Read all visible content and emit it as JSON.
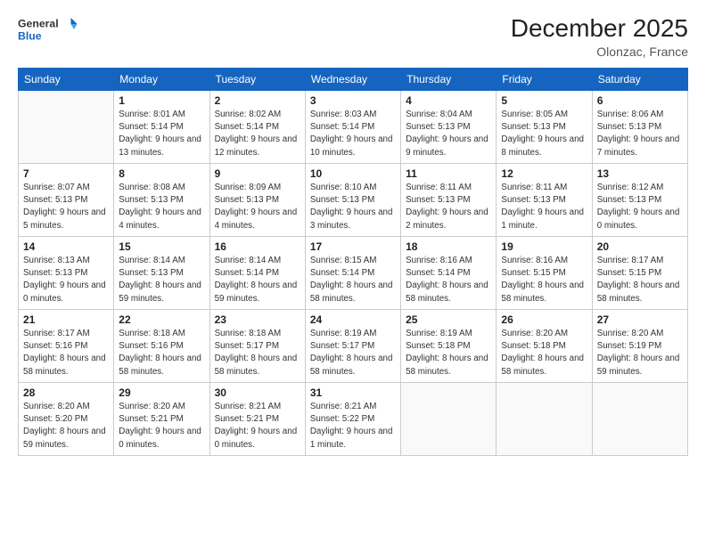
{
  "logo": {
    "line1": "General",
    "line2": "Blue"
  },
  "title": "December 2025",
  "location": "Olonzac, France",
  "days_header": [
    "Sunday",
    "Monday",
    "Tuesday",
    "Wednesday",
    "Thursday",
    "Friday",
    "Saturday"
  ],
  "weeks": [
    [
      {
        "num": "",
        "empty": true
      },
      {
        "num": "1",
        "sunrise": "Sunrise: 8:01 AM",
        "sunset": "Sunset: 5:14 PM",
        "daylight": "Daylight: 9 hours and 13 minutes."
      },
      {
        "num": "2",
        "sunrise": "Sunrise: 8:02 AM",
        "sunset": "Sunset: 5:14 PM",
        "daylight": "Daylight: 9 hours and 12 minutes."
      },
      {
        "num": "3",
        "sunrise": "Sunrise: 8:03 AM",
        "sunset": "Sunset: 5:14 PM",
        "daylight": "Daylight: 9 hours and 10 minutes."
      },
      {
        "num": "4",
        "sunrise": "Sunrise: 8:04 AM",
        "sunset": "Sunset: 5:13 PM",
        "daylight": "Daylight: 9 hours and 9 minutes."
      },
      {
        "num": "5",
        "sunrise": "Sunrise: 8:05 AM",
        "sunset": "Sunset: 5:13 PM",
        "daylight": "Daylight: 9 hours and 8 minutes."
      },
      {
        "num": "6",
        "sunrise": "Sunrise: 8:06 AM",
        "sunset": "Sunset: 5:13 PM",
        "daylight": "Daylight: 9 hours and 7 minutes."
      }
    ],
    [
      {
        "num": "7",
        "sunrise": "Sunrise: 8:07 AM",
        "sunset": "Sunset: 5:13 PM",
        "daylight": "Daylight: 9 hours and 5 minutes."
      },
      {
        "num": "8",
        "sunrise": "Sunrise: 8:08 AM",
        "sunset": "Sunset: 5:13 PM",
        "daylight": "Daylight: 9 hours and 4 minutes."
      },
      {
        "num": "9",
        "sunrise": "Sunrise: 8:09 AM",
        "sunset": "Sunset: 5:13 PM",
        "daylight": "Daylight: 9 hours and 4 minutes."
      },
      {
        "num": "10",
        "sunrise": "Sunrise: 8:10 AM",
        "sunset": "Sunset: 5:13 PM",
        "daylight": "Daylight: 9 hours and 3 minutes."
      },
      {
        "num": "11",
        "sunrise": "Sunrise: 8:11 AM",
        "sunset": "Sunset: 5:13 PM",
        "daylight": "Daylight: 9 hours and 2 minutes."
      },
      {
        "num": "12",
        "sunrise": "Sunrise: 8:11 AM",
        "sunset": "Sunset: 5:13 PM",
        "daylight": "Daylight: 9 hours and 1 minute."
      },
      {
        "num": "13",
        "sunrise": "Sunrise: 8:12 AM",
        "sunset": "Sunset: 5:13 PM",
        "daylight": "Daylight: 9 hours and 0 minutes."
      }
    ],
    [
      {
        "num": "14",
        "sunrise": "Sunrise: 8:13 AM",
        "sunset": "Sunset: 5:13 PM",
        "daylight": "Daylight: 9 hours and 0 minutes."
      },
      {
        "num": "15",
        "sunrise": "Sunrise: 8:14 AM",
        "sunset": "Sunset: 5:13 PM",
        "daylight": "Daylight: 8 hours and 59 minutes."
      },
      {
        "num": "16",
        "sunrise": "Sunrise: 8:14 AM",
        "sunset": "Sunset: 5:14 PM",
        "daylight": "Daylight: 8 hours and 59 minutes."
      },
      {
        "num": "17",
        "sunrise": "Sunrise: 8:15 AM",
        "sunset": "Sunset: 5:14 PM",
        "daylight": "Daylight: 8 hours and 58 minutes."
      },
      {
        "num": "18",
        "sunrise": "Sunrise: 8:16 AM",
        "sunset": "Sunset: 5:14 PM",
        "daylight": "Daylight: 8 hours and 58 minutes."
      },
      {
        "num": "19",
        "sunrise": "Sunrise: 8:16 AM",
        "sunset": "Sunset: 5:15 PM",
        "daylight": "Daylight: 8 hours and 58 minutes."
      },
      {
        "num": "20",
        "sunrise": "Sunrise: 8:17 AM",
        "sunset": "Sunset: 5:15 PM",
        "daylight": "Daylight: 8 hours and 58 minutes."
      }
    ],
    [
      {
        "num": "21",
        "sunrise": "Sunrise: 8:17 AM",
        "sunset": "Sunset: 5:16 PM",
        "daylight": "Daylight: 8 hours and 58 minutes."
      },
      {
        "num": "22",
        "sunrise": "Sunrise: 8:18 AM",
        "sunset": "Sunset: 5:16 PM",
        "daylight": "Daylight: 8 hours and 58 minutes."
      },
      {
        "num": "23",
        "sunrise": "Sunrise: 8:18 AM",
        "sunset": "Sunset: 5:17 PM",
        "daylight": "Daylight: 8 hours and 58 minutes."
      },
      {
        "num": "24",
        "sunrise": "Sunrise: 8:19 AM",
        "sunset": "Sunset: 5:17 PM",
        "daylight": "Daylight: 8 hours and 58 minutes."
      },
      {
        "num": "25",
        "sunrise": "Sunrise: 8:19 AM",
        "sunset": "Sunset: 5:18 PM",
        "daylight": "Daylight: 8 hours and 58 minutes."
      },
      {
        "num": "26",
        "sunrise": "Sunrise: 8:20 AM",
        "sunset": "Sunset: 5:18 PM",
        "daylight": "Daylight: 8 hours and 58 minutes."
      },
      {
        "num": "27",
        "sunrise": "Sunrise: 8:20 AM",
        "sunset": "Sunset: 5:19 PM",
        "daylight": "Daylight: 8 hours and 59 minutes."
      }
    ],
    [
      {
        "num": "28",
        "sunrise": "Sunrise: 8:20 AM",
        "sunset": "Sunset: 5:20 PM",
        "daylight": "Daylight: 8 hours and 59 minutes."
      },
      {
        "num": "29",
        "sunrise": "Sunrise: 8:20 AM",
        "sunset": "Sunset: 5:21 PM",
        "daylight": "Daylight: 9 hours and 0 minutes."
      },
      {
        "num": "30",
        "sunrise": "Sunrise: 8:21 AM",
        "sunset": "Sunset: 5:21 PM",
        "daylight": "Daylight: 9 hours and 0 minutes."
      },
      {
        "num": "31",
        "sunrise": "Sunrise: 8:21 AM",
        "sunset": "Sunset: 5:22 PM",
        "daylight": "Daylight: 9 hours and 1 minute."
      },
      {
        "num": "",
        "empty": true
      },
      {
        "num": "",
        "empty": true
      },
      {
        "num": "",
        "empty": true
      }
    ]
  ]
}
